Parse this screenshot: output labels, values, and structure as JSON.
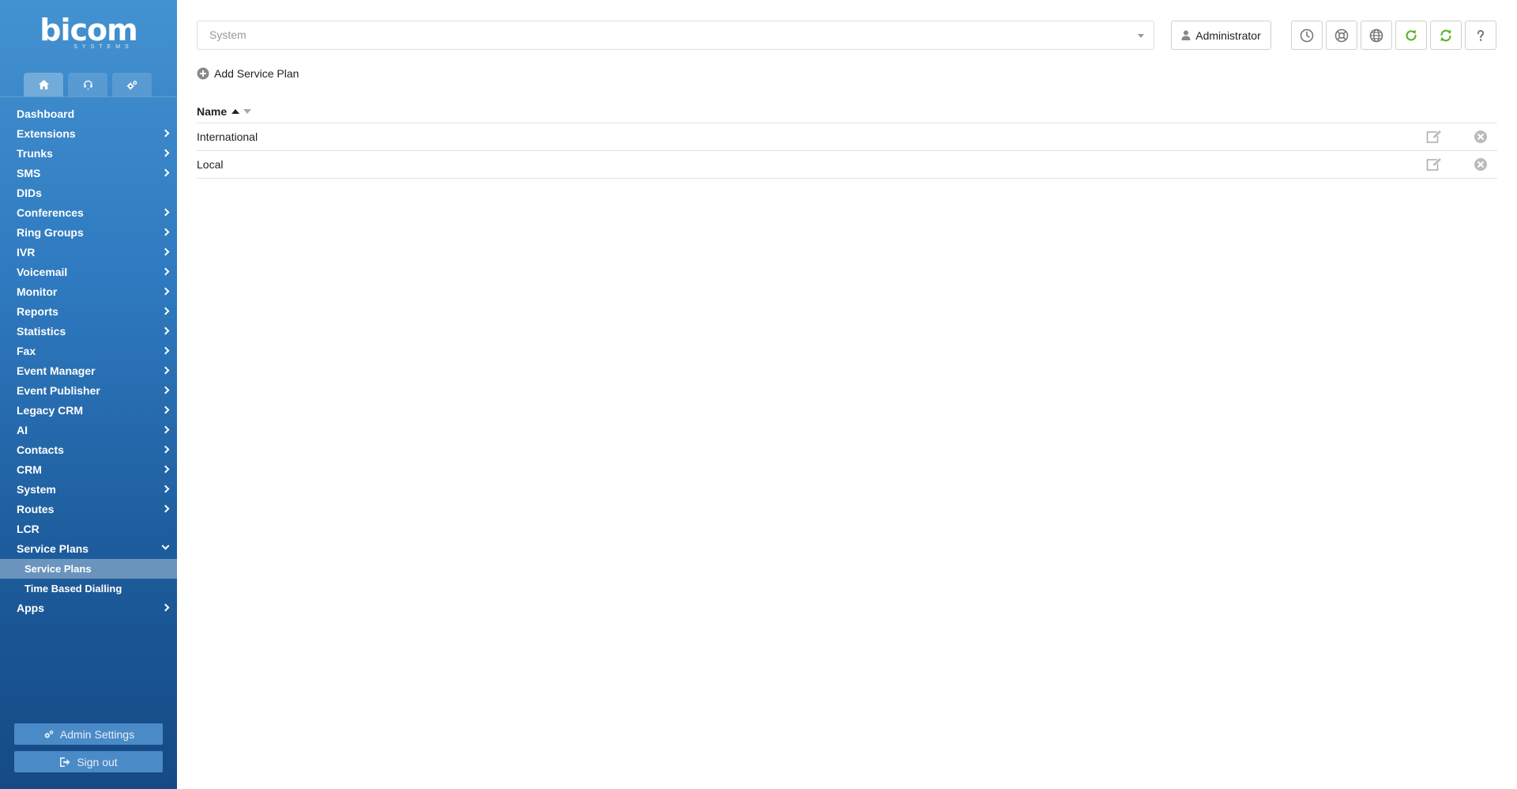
{
  "brand": {
    "logo_word": "bicom",
    "logo_sub": "SYSTEMS"
  },
  "sidebar": {
    "tabs": [
      {
        "icon": "home-icon"
      },
      {
        "icon": "headset-icon"
      },
      {
        "icon": "gears-icon"
      }
    ],
    "items": [
      {
        "label": "Dashboard",
        "has_children": false
      },
      {
        "label": "Extensions",
        "has_children": true
      },
      {
        "label": "Trunks",
        "has_children": true
      },
      {
        "label": "SMS",
        "has_children": true
      },
      {
        "label": "DIDs",
        "has_children": false
      },
      {
        "label": "Conferences",
        "has_children": true
      },
      {
        "label": "Ring Groups",
        "has_children": true
      },
      {
        "label": "IVR",
        "has_children": true
      },
      {
        "label": "Voicemail",
        "has_children": true
      },
      {
        "label": "Monitor",
        "has_children": true
      },
      {
        "label": "Reports",
        "has_children": true
      },
      {
        "label": "Statistics",
        "has_children": true
      },
      {
        "label": "Fax",
        "has_children": true
      },
      {
        "label": "Event Manager",
        "has_children": true
      },
      {
        "label": "Event Publisher",
        "has_children": true
      },
      {
        "label": "Legacy CRM",
        "has_children": true
      },
      {
        "label": "AI",
        "has_children": true
      },
      {
        "label": "Contacts",
        "has_children": true
      },
      {
        "label": "CRM",
        "has_children": true
      },
      {
        "label": "System",
        "has_children": true
      },
      {
        "label": "Routes",
        "has_children": true
      },
      {
        "label": "LCR",
        "has_children": false
      },
      {
        "label": "Service Plans",
        "has_children": true,
        "expanded": true
      },
      {
        "label": "Apps",
        "has_children": true
      }
    ],
    "service_plans_sub": [
      {
        "label": "Service Plans",
        "active": true
      },
      {
        "label": "Time Based Dialling",
        "active": false
      }
    ],
    "admin_settings": "Admin Settings",
    "sign_out": "Sign out"
  },
  "header": {
    "tenant_select": {
      "value": "System"
    },
    "user_button": "Administrator",
    "toolbar_icons": [
      "clock-icon",
      "support-icon",
      "globe-icon",
      "reload-icon",
      "sync-icon",
      "help-icon"
    ]
  },
  "main": {
    "add_link": "Add Service Plan",
    "table": {
      "column_name": "Name",
      "rows": [
        {
          "name": "International"
        },
        {
          "name": "Local"
        }
      ]
    }
  },
  "colors": {
    "sidebar_top": "#4392d0",
    "sidebar_bottom": "#154a85",
    "accent_green": "#5cb52d"
  }
}
